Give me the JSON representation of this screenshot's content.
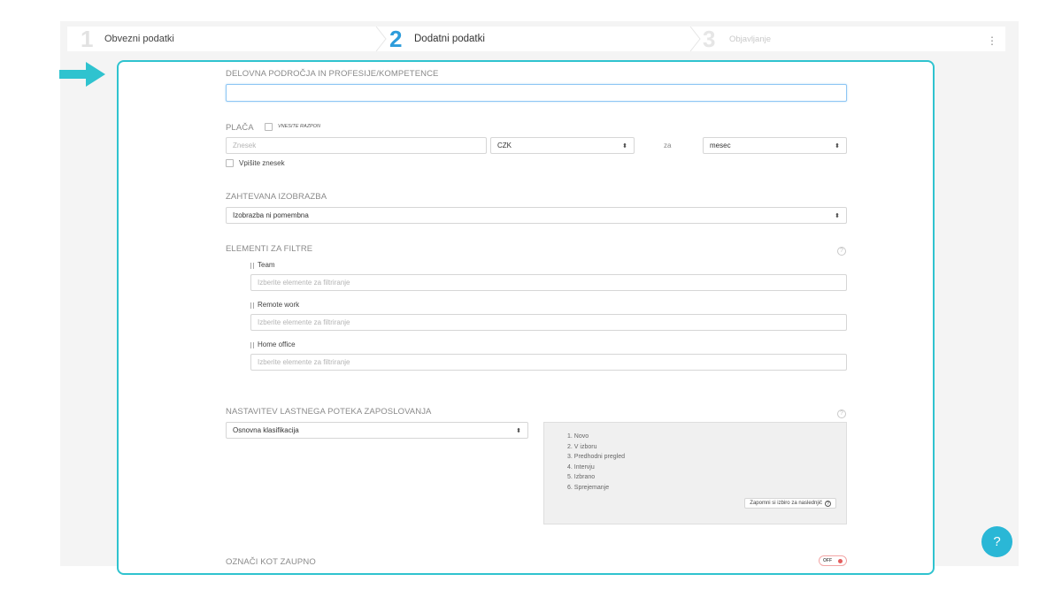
{
  "wizard": {
    "steps": [
      {
        "number": "1",
        "label": "Obvezni podatki"
      },
      {
        "number": "2",
        "label": "Dodatni podatki"
      },
      {
        "number": "3",
        "label": "Objavljanje"
      }
    ],
    "menu_icon": "kebab-menu-icon",
    "menu_glyph": "⋮"
  },
  "colors": {
    "accent": "#2fc3cf",
    "active_step": "#2d9cdb",
    "inactive_step": "#cfcfcf",
    "toggle_off": "#e35d5d"
  },
  "form": {
    "areas": {
      "title": "DELOVNA PODROČJA IN PROFESIJE/KOMPETENCE",
      "value": ""
    },
    "salary": {
      "title": "PLAČA",
      "range_label": "VNESITE RAZPON",
      "amount_placeholder": "Znesek",
      "currency": "CZK",
      "per_label": "za",
      "period": "mesec",
      "enter_amount_label": "Vpišite znesek"
    },
    "education": {
      "title": "ZAHTEVANA IZOBRAZBA",
      "value": "Izobrazba ni pomembna"
    },
    "filters": {
      "title": "ELEMENTI ZA FILTRE",
      "info_glyph": "?",
      "items": [
        {
          "label": "Team",
          "placeholder": "Izberite elemente za filtriranje"
        },
        {
          "label": "Remote work",
          "placeholder": "Izberite elemente za filtriranje"
        },
        {
          "label": "Home office",
          "placeholder": "Izberite elemente za filtriranje"
        }
      ]
    },
    "workflow": {
      "title": "NASTAVITEV LASTNEGA POTEKA ZAPOSLOVANJA",
      "info_glyph": "?",
      "value": "Osnovna klasifikacija",
      "stages": [
        "1. Novo",
        "2. V izboru",
        "3. Predhodni pregled",
        "4. Intervju",
        "5. Izbrano",
        "6. Sprejemanje"
      ],
      "remember_label": "Zapomni si izbiro za naslednjič",
      "remember_icon": "?"
    },
    "confidential": {
      "title": "OZNAČI KOT ZAUPNO",
      "toggle_label": "OFF",
      "toggle_state": "off"
    },
    "select_glyph": "⬍"
  },
  "help_button": {
    "glyph": "?"
  }
}
